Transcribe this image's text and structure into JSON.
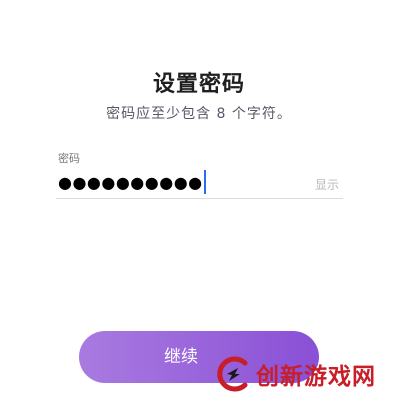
{
  "header": {
    "title": "设置密码",
    "subtitle": "密码应至少包含 8 个字符。"
  },
  "password_field": {
    "label": "密码",
    "value": "●●●●●●●●●●",
    "show_toggle_label": "显示"
  },
  "continue_button": {
    "label": "继续"
  },
  "watermark": {
    "text": "创新游戏网"
  },
  "colors": {
    "button_start": "#a97be0",
    "button_end": "#8a4fd6",
    "caret": "#2c6df0",
    "watermark": "#c81e28"
  }
}
